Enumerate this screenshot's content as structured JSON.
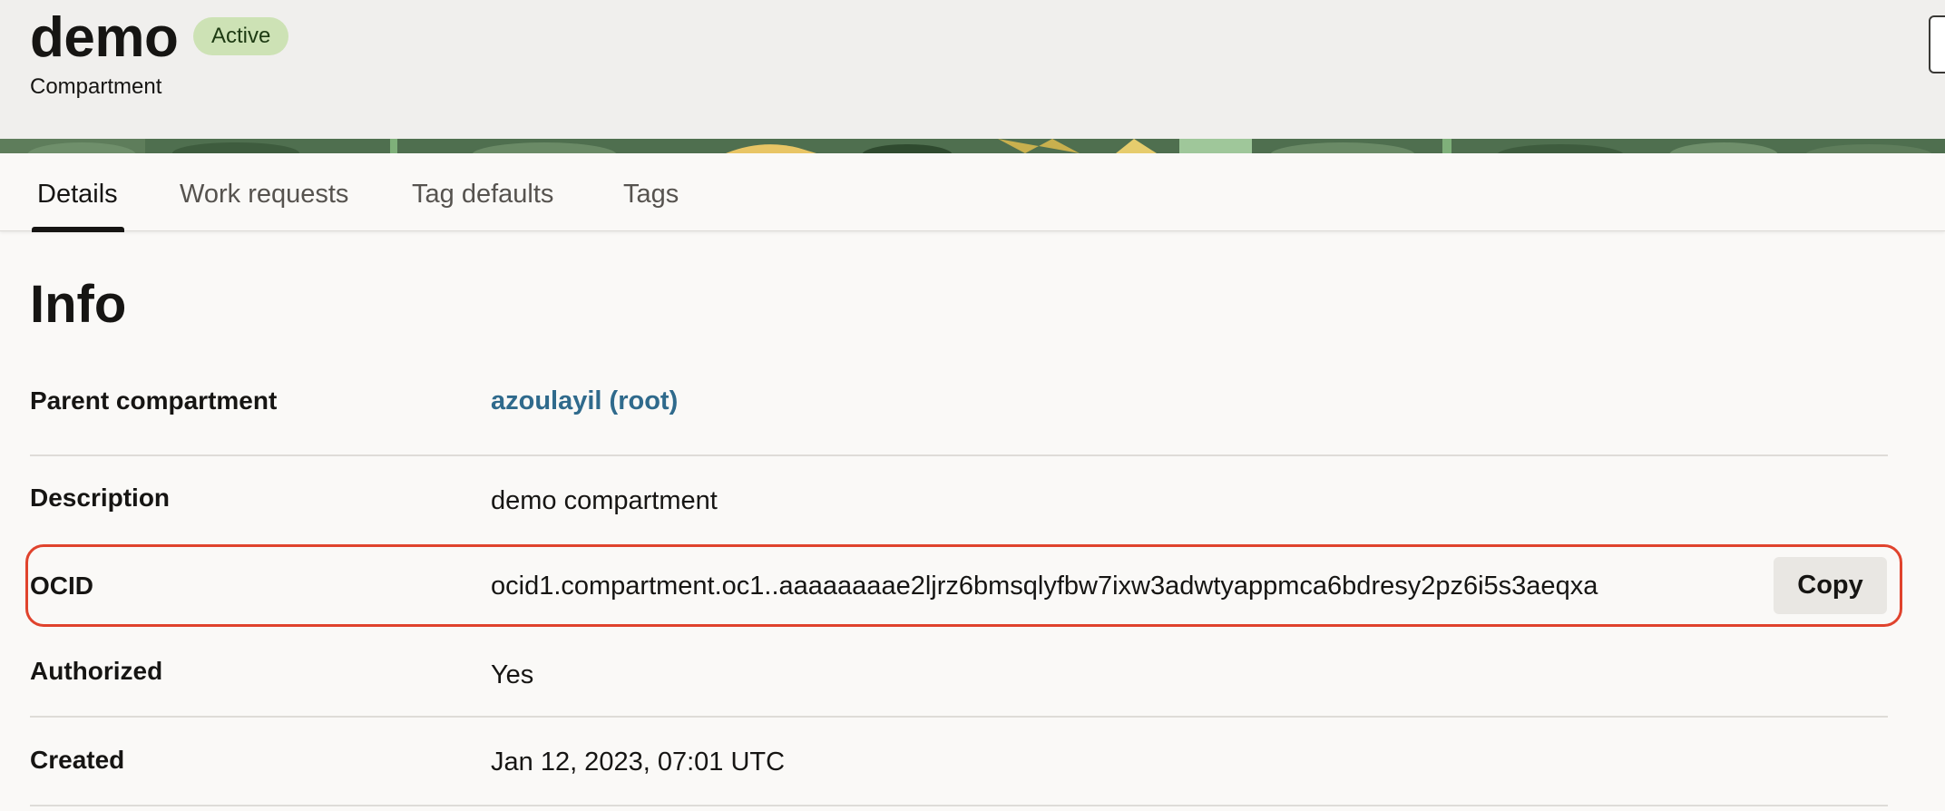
{
  "header": {
    "title": "demo",
    "status": "Active",
    "subtitle": "Compartment"
  },
  "tabs": [
    {
      "label": "Details",
      "active": true
    },
    {
      "label": "Work requests",
      "active": false
    },
    {
      "label": "Tag defaults",
      "active": false
    },
    {
      "label": "Tags",
      "active": false
    }
  ],
  "info": {
    "title": "Info",
    "rows": [
      {
        "label": "Parent compartment",
        "value": "azoulayil (root)"
      },
      {
        "label": "Description",
        "value": "demo compartment"
      },
      {
        "label": "OCID",
        "value": "ocid1.compartment.oc1..aaaaaaaae2ljrz6bmsqlyfbw7ixw3adwtyappmca6bdresy2pz6i5s3aeqxa"
      },
      {
        "label": "Authorized",
        "value": "Yes"
      },
      {
        "label": "Created",
        "value": "Jan 12, 2023, 07:01 UTC"
      }
    ],
    "copy_label": "Copy"
  },
  "colors": {
    "badge_bg": "#cde2b5",
    "link": "#2f6a8c",
    "highlight_border": "#e0432d"
  }
}
